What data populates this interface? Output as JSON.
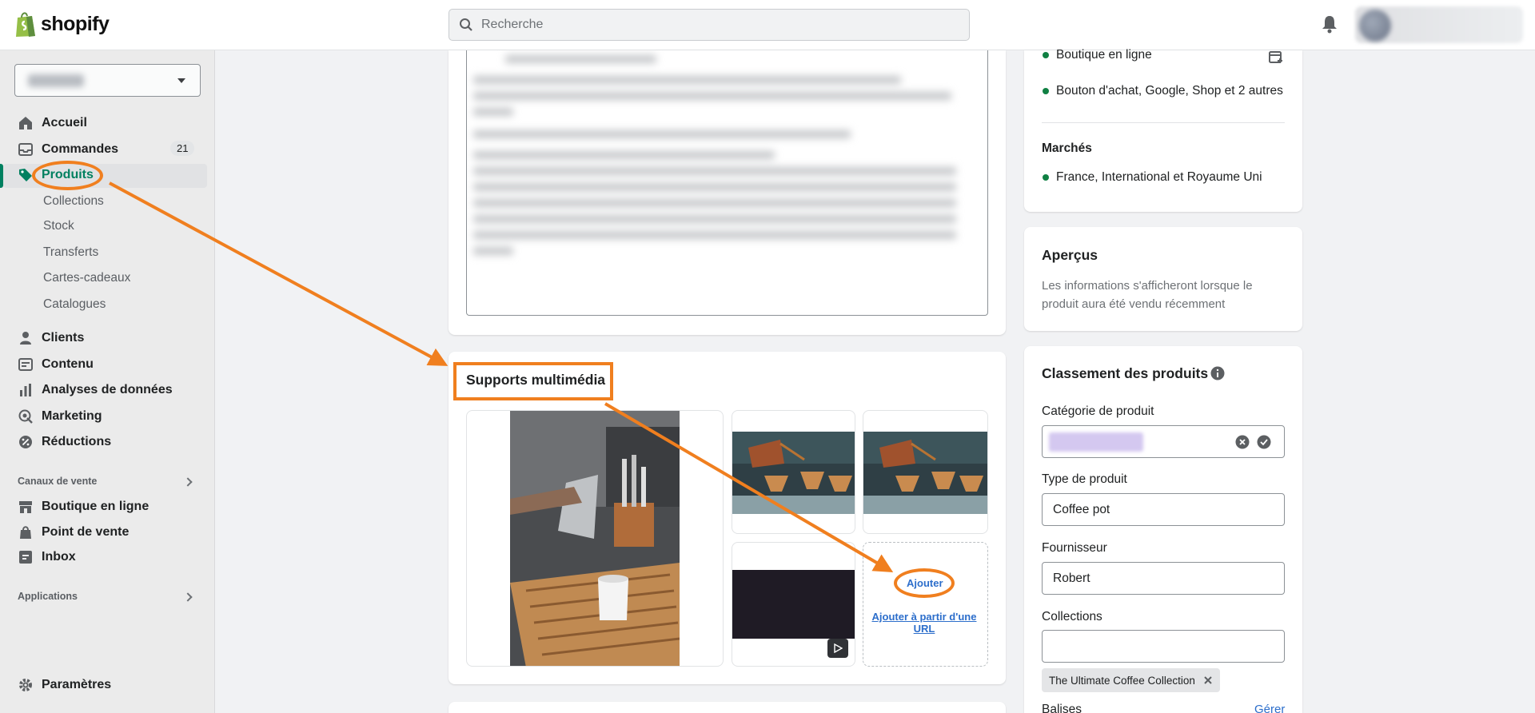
{
  "brand": {
    "name": "shopify",
    "green": "#008060",
    "link": "#2c6ecb",
    "annotation": "#f07f1f"
  },
  "search": {
    "placeholder": "Recherche"
  },
  "sidebar": {
    "items": [
      {
        "label": "Accueil",
        "icon": "home-icon"
      },
      {
        "label": "Commandes",
        "icon": "inbox-icon",
        "badge": "21"
      },
      {
        "label": "Produits",
        "icon": "tag-icon"
      },
      {
        "label": "Clients",
        "icon": "person-icon"
      },
      {
        "label": "Contenu",
        "icon": "content-icon"
      },
      {
        "label": "Analyses de données",
        "icon": "bar-chart-icon"
      },
      {
        "label": "Marketing",
        "icon": "target-icon"
      },
      {
        "label": "Réductions",
        "icon": "discount-icon"
      }
    ],
    "product_sub": [
      "Collections",
      "Stock",
      "Transferts",
      "Cartes-cadeaux",
      "Catalogues"
    ],
    "sales_channels_label": "Canaux de vente",
    "channels": [
      {
        "label": "Boutique en ligne",
        "icon": "store-icon"
      },
      {
        "label": "Point de vente",
        "icon": "pos-icon"
      },
      {
        "label": "Inbox",
        "icon": "chat-icon"
      }
    ],
    "apps_label": "Applications",
    "settings_label": "Paramètres"
  },
  "main": {
    "media": {
      "title": "Supports multimédia",
      "add_label": "Ajouter",
      "add_url_label": "Ajouter à partir d'une URL"
    }
  },
  "right": {
    "channels": [
      "Boutique en ligne",
      "Bouton d'achat, Google, Shop et 2 autres"
    ],
    "markets_title": "Marchés",
    "markets": "France, International et Royaume Uni",
    "insights_title": "Aperçus",
    "insights_text": "Les informations s'afficheront lorsque le produit aura été vendu récemment",
    "org_title": "Classement des produits",
    "category_label": "Catégorie de produit",
    "type_label": "Type de produit",
    "type_value": "Coffee pot",
    "vendor_label": "Fournisseur",
    "vendor_value": "Robert",
    "collections_label": "Collections",
    "collection_tag": "The Ultimate Coffee Collection",
    "tags_label": "Balises",
    "manage_label": "Gérer"
  }
}
